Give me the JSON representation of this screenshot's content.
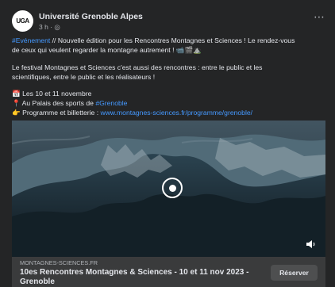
{
  "post": {
    "author": "Université Grenoble Alpes",
    "avatar_text": "UGA",
    "time": "3 h",
    "visibility_icon": "globe-icon",
    "more_icon": "more-icon",
    "hashtag_1": "#Evénement",
    "line_1": " // Nouvelle édition pour les Rencontres Montagnes et Sciences ! Le rendez-vous",
    "line_2": "de ceux qui veulent regarder la montagne autrement ! 📹🎬⛰️",
    "line_3": "Le festival Montagnes et Sciences c'est aussi des rencontres : entre le public et les",
    "line_4": "scientifiques, entre le public et les réalisateurs !",
    "date_icon": "📅",
    "date": "Les 10 et 11 novembre",
    "location_icon": "📍",
    "location_prefix": "Au Palais des sports de ",
    "location_hashtag": "#Grenoble",
    "program_icon": "👉",
    "program_prefix": "Programme et billetterie : ",
    "program_url": "www.montagnes-sciences.fr/programme/grenoble/"
  },
  "media": {
    "play_icon": "play-icon",
    "sound_icon": "speaker-icon"
  },
  "link_preview": {
    "domain": "MONTAGNES-SCIENCES.FR",
    "title": "10es Rencontres Montagnes & Sciences - 10 et 11 nov 2023 - Grenoble",
    "button": "Réserver"
  }
}
